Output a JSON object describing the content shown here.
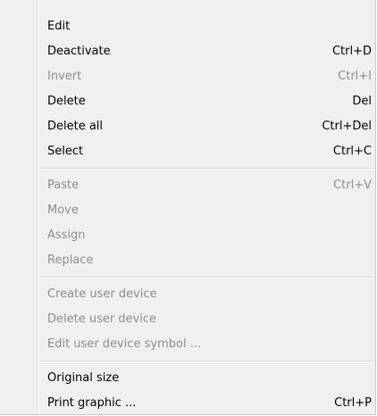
{
  "menu": {
    "group1": [
      {
        "label": "Edit",
        "shortcut": "",
        "enabled": true
      },
      {
        "label": "Deactivate",
        "shortcut": "Ctrl+D",
        "enabled": true
      },
      {
        "label": "Invert",
        "shortcut": "Ctrl+I",
        "enabled": false
      },
      {
        "label": "Delete",
        "shortcut": "Del",
        "enabled": true
      },
      {
        "label": "Delete all",
        "shortcut": "Ctrl+Del",
        "enabled": true
      },
      {
        "label": "Select",
        "shortcut": "Ctrl+C",
        "enabled": true
      }
    ],
    "group2": [
      {
        "label": "Paste",
        "shortcut": "Ctrl+V",
        "enabled": false
      },
      {
        "label": "Move",
        "shortcut": "",
        "enabled": false
      },
      {
        "label": "Assign",
        "shortcut": "",
        "enabled": false
      },
      {
        "label": "Replace",
        "shortcut": "",
        "enabled": false
      }
    ],
    "group3": [
      {
        "label": "Create user device",
        "shortcut": "",
        "enabled": false
      },
      {
        "label": "Delete user device",
        "shortcut": "",
        "enabled": false
      },
      {
        "label": "Edit user device symbol ...",
        "shortcut": "",
        "enabled": false
      }
    ],
    "group4": [
      {
        "label": "Original size",
        "shortcut": "",
        "enabled": true
      },
      {
        "label": "Print graphic ...",
        "shortcut": "Ctrl+P",
        "enabled": true
      }
    ],
    "colors": {
      "background": "#f0f0f0",
      "enabled_text": "#000000",
      "disabled_text": "#8d8d8d",
      "separator": "#d7d7d7"
    }
  }
}
